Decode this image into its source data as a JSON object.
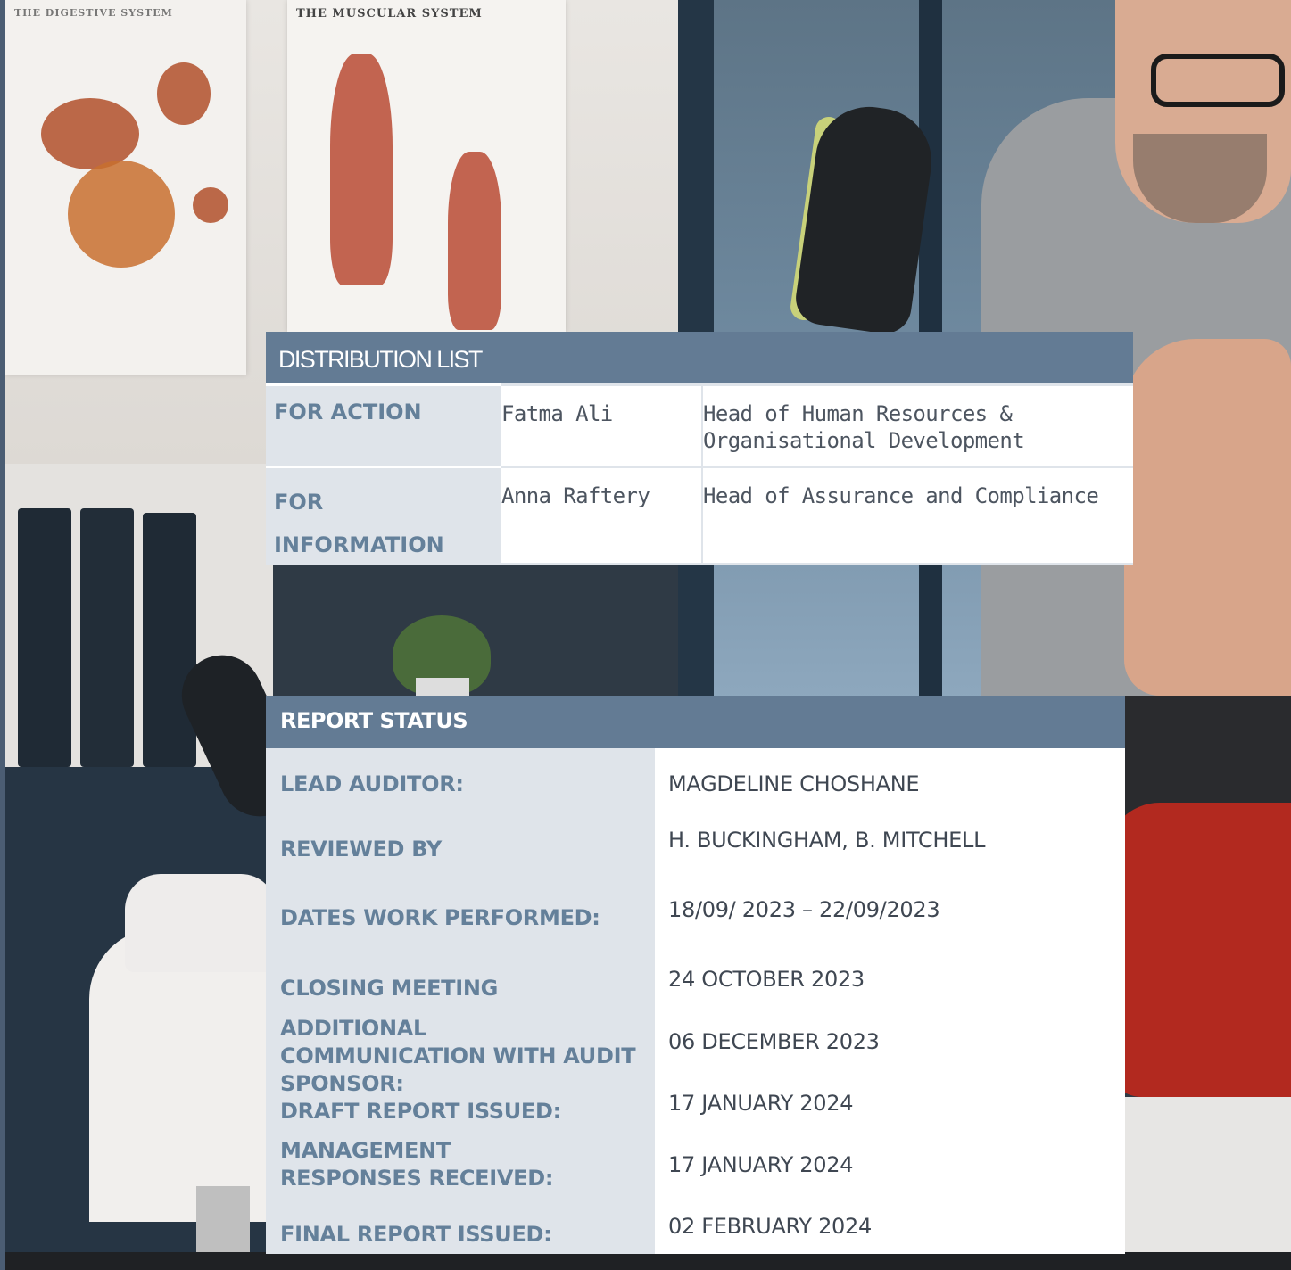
{
  "distribution_list": {
    "title": "DISTRIBUTION LIST",
    "rows": [
      {
        "label": "FOR ACTION",
        "name": "Fatma Ali",
        "role": "Head of Human Resources & Organisational Development"
      },
      {
        "label": "FOR INFORMATION",
        "name": "Anna Raftery",
        "role": "Head of Assurance and Compliance"
      }
    ]
  },
  "report_status": {
    "title": "REPORT STATUS",
    "rows": [
      {
        "label": "LEAD AUDITOR:",
        "value": "MAGDELINE CHOSHANE"
      },
      {
        "label": "REVIEWED BY",
        "value": "H. BUCKINGHAM, B. MITCHELL"
      },
      {
        "label": "DATES WORK PERFORMED:",
        "value": "18/09/ 2023 – 22/09/2023"
      },
      {
        "label": "CLOSING MEETING",
        "value": "24 OCTOBER 2023"
      },
      {
        "label": "ADDITIONAL COMMUNICATION WITH AUDIT SPONSOR:",
        "value": "06 DECEMBER 2023"
      },
      {
        "label": "DRAFT REPORT ISSUED:",
        "value": "17 JANUARY 2024"
      },
      {
        "label": "MANAGEMENT RESPONSES RECEIVED:",
        "value": "17 JANUARY 2024"
      },
      {
        "label": "FINAL REPORT ISSUED:",
        "value": "02 FEBRUARY 2024"
      }
    ]
  },
  "poster_titles": {
    "left": "THE DIGESTIVE SYSTEM",
    "right": "THE MUSCULAR SYSTEM"
  },
  "colors": {
    "header_bg": "#637b94",
    "label_bg": "#dfe4ea",
    "label_text": "#64809a"
  }
}
